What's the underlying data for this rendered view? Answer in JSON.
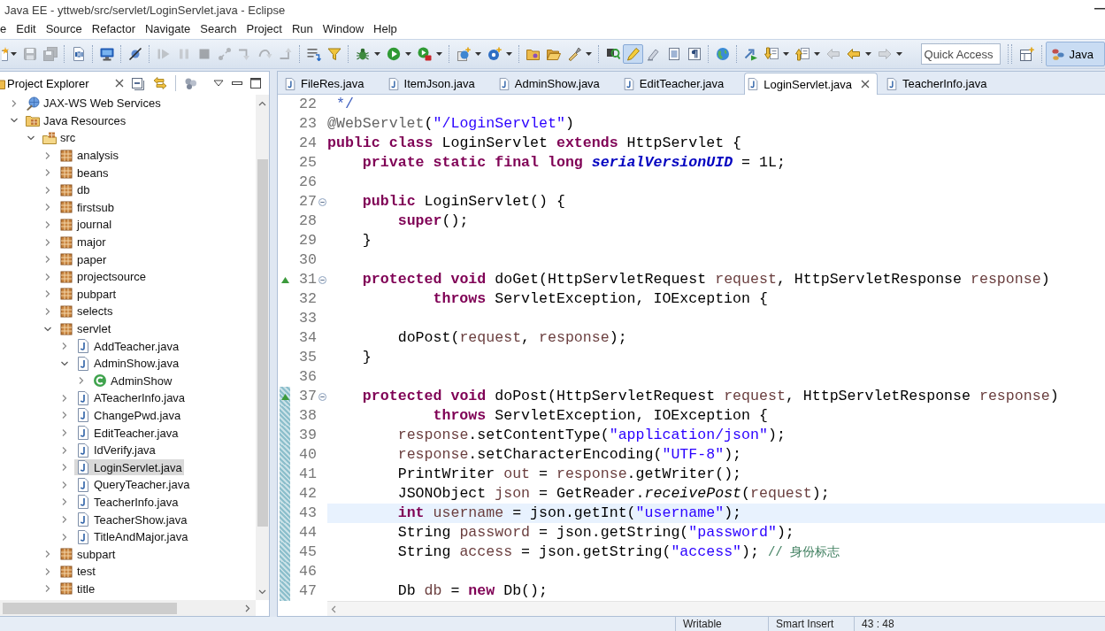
{
  "window": {
    "title": "Java EE - yttweb/src/servlet/LoginServlet.java - Eclipse"
  },
  "menu": [
    "e",
    "Edit",
    "Source",
    "Refactor",
    "Navigate",
    "Search",
    "Project",
    "Run",
    "Window",
    "Help"
  ],
  "toolbar": {
    "groups": [
      {
        "items": [
          {
            "kind": "new",
            "disabled": false,
            "pressed": false,
            "dropdown": true
          },
          {
            "kind": "save",
            "disabled": true,
            "pressed": false,
            "dropdown": false
          },
          {
            "kind": "save-all",
            "disabled": true,
            "pressed": false,
            "dropdown": false
          }
        ]
      },
      {
        "items": [
          {
            "kind": "binary",
            "disabled": false,
            "pressed": false,
            "dropdown": false
          }
        ]
      },
      {
        "items": [
          {
            "kind": "monitor",
            "disabled": false,
            "pressed": false,
            "dropdown": false
          }
        ]
      },
      {
        "items": [
          {
            "kind": "skip-breakpoints",
            "disabled": false,
            "pressed": false,
            "dropdown": false
          }
        ]
      },
      {
        "items": [
          {
            "kind": "resume",
            "disabled": true,
            "pressed": false,
            "dropdown": false
          },
          {
            "kind": "suspend",
            "disabled": true,
            "pressed": false,
            "dropdown": false
          },
          {
            "kind": "terminate",
            "disabled": true,
            "pressed": false,
            "dropdown": false
          },
          {
            "kind": "disconnect",
            "disabled": true,
            "pressed": false,
            "dropdown": false
          },
          {
            "kind": "step-into",
            "disabled": true,
            "pressed": false,
            "dropdown": false
          },
          {
            "kind": "step-over",
            "disabled": true,
            "pressed": false,
            "dropdown": false
          },
          {
            "kind": "step-return",
            "disabled": true,
            "pressed": false,
            "dropdown": false
          }
        ]
      },
      {
        "items": [
          {
            "kind": "step-filters",
            "disabled": false,
            "pressed": false,
            "dropdown": false
          },
          {
            "kind": "funnel",
            "disabled": false,
            "pressed": false,
            "dropdown": false
          }
        ]
      },
      {
        "items": [
          {
            "kind": "debug",
            "disabled": false,
            "pressed": false,
            "dropdown": true
          },
          {
            "kind": "run",
            "disabled": false,
            "pressed": false,
            "dropdown": true
          },
          {
            "kind": "external-tools",
            "disabled": false,
            "pressed": false,
            "dropdown": true
          }
        ]
      },
      {
        "items": [
          {
            "kind": "new-server",
            "disabled": false,
            "pressed": false,
            "dropdown": true
          },
          {
            "kind": "new-class",
            "disabled": false,
            "pressed": false,
            "dropdown": true
          }
        ]
      },
      {
        "items": [
          {
            "kind": "open-type",
            "disabled": false,
            "pressed": false,
            "dropdown": false
          },
          {
            "kind": "open-folder",
            "disabled": false,
            "pressed": false,
            "dropdown": false
          },
          {
            "kind": "brush",
            "disabled": false,
            "pressed": false,
            "dropdown": true
          }
        ]
      },
      {
        "items": [
          {
            "kind": "search-marker",
            "disabled": false,
            "pressed": false,
            "dropdown": false
          },
          {
            "kind": "highlighter",
            "disabled": false,
            "pressed": true,
            "dropdown": false
          },
          {
            "kind": "mark-occurrences",
            "disabled": false,
            "pressed": false,
            "dropdown": false
          },
          {
            "kind": "block-selection",
            "disabled": false,
            "pressed": false,
            "dropdown": false
          },
          {
            "kind": "whitespace",
            "disabled": false,
            "pressed": false,
            "dropdown": false
          }
        ]
      },
      {
        "items": [
          {
            "kind": "globe",
            "disabled": false,
            "pressed": false,
            "dropdown": false
          }
        ]
      },
      {
        "items": [
          {
            "kind": "run-last",
            "disabled": false,
            "pressed": false,
            "dropdown": false
          },
          {
            "kind": "next-annotation",
            "disabled": false,
            "pressed": false,
            "dropdown": true
          },
          {
            "kind": "prev-annotation",
            "disabled": false,
            "pressed": false,
            "dropdown": true
          },
          {
            "kind": "back-edit",
            "disabled": true,
            "pressed": false,
            "dropdown": false
          },
          {
            "kind": "back",
            "disabled": false,
            "pressed": false,
            "dropdown": true
          },
          {
            "kind": "forward",
            "disabled": true,
            "pressed": false,
            "dropdown": true
          }
        ]
      }
    ],
    "quick_access": {
      "placeholder": "Quick Access"
    },
    "perspectives": [
      {
        "label": "Java",
        "selected": true
      }
    ]
  },
  "project_explorer": {
    "title": "Project Explorer",
    "tree": [
      {
        "label": "JAX-WS Web Services",
        "kind": "services",
        "expanded": false,
        "selected": false
      },
      {
        "label": "Java Resources",
        "kind": "resources",
        "expanded": true,
        "selected": false,
        "children": [
          {
            "label": "src",
            "kind": "source-folder",
            "expanded": true,
            "selected": false,
            "children": [
              {
                "label": "analysis",
                "kind": "package",
                "expanded": false,
                "selected": false
              },
              {
                "label": "beans",
                "kind": "package",
                "expanded": false,
                "selected": false
              },
              {
                "label": "db",
                "kind": "package",
                "expanded": false,
                "selected": false
              },
              {
                "label": "firstsub",
                "kind": "package",
                "expanded": false,
                "selected": false
              },
              {
                "label": "journal",
                "kind": "package",
                "expanded": false,
                "selected": false
              },
              {
                "label": "major",
                "kind": "package",
                "expanded": false,
                "selected": false
              },
              {
                "label": "paper",
                "kind": "package",
                "expanded": false,
                "selected": false
              },
              {
                "label": "projectsource",
                "kind": "package",
                "expanded": false,
                "selected": false
              },
              {
                "label": "pubpart",
                "kind": "package",
                "expanded": false,
                "selected": false
              },
              {
                "label": "selects",
                "kind": "package",
                "expanded": false,
                "selected": false
              },
              {
                "label": "servlet",
                "kind": "package",
                "expanded": true,
                "selected": false,
                "children": [
                  {
                    "label": "AddTeacher.java",
                    "kind": "java-file",
                    "expanded": false,
                    "selected": false
                  },
                  {
                    "label": "AdminShow.java",
                    "kind": "java-file",
                    "expanded": true,
                    "selected": false,
                    "children": [
                      {
                        "label": "AdminShow",
                        "kind": "class",
                        "expanded": false,
                        "selected": false
                      }
                    ]
                  },
                  {
                    "label": "ATeacherInfo.java",
                    "kind": "java-file",
                    "expanded": false,
                    "selected": false
                  },
                  {
                    "label": "ChangePwd.java",
                    "kind": "java-file",
                    "expanded": false,
                    "selected": false
                  },
                  {
                    "label": "EditTeacher.java",
                    "kind": "java-file",
                    "expanded": false,
                    "selected": false
                  },
                  {
                    "label": "IdVerify.java",
                    "kind": "java-file",
                    "expanded": false,
                    "selected": false
                  },
                  {
                    "label": "LoginServlet.java",
                    "kind": "java-file",
                    "expanded": false,
                    "selected": true
                  },
                  {
                    "label": "QueryTeacher.java",
                    "kind": "java-file",
                    "expanded": false,
                    "selected": false
                  },
                  {
                    "label": "TeacherInfo.java",
                    "kind": "java-file",
                    "expanded": false,
                    "selected": false
                  },
                  {
                    "label": "TeacherShow.java",
                    "kind": "java-file",
                    "expanded": false,
                    "selected": false
                  },
                  {
                    "label": "TitleAndMajor.java",
                    "kind": "java-file",
                    "expanded": false,
                    "selected": false
                  }
                ]
              },
              {
                "label": "subpart",
                "kind": "package",
                "expanded": false,
                "selected": false
              },
              {
                "label": "test",
                "kind": "package",
                "expanded": false,
                "selected": false
              },
              {
                "label": "title",
                "kind": "package",
                "expanded": false,
                "selected": false
              }
            ]
          }
        ]
      }
    ]
  },
  "editor": {
    "tabs": [
      {
        "label": "FileRes.java",
        "selected": false
      },
      {
        "label": "ItemJson.java",
        "selected": false
      },
      {
        "label": "AdminShow.java",
        "selected": false
      },
      {
        "label": "EditTeacher.java",
        "selected": false
      },
      {
        "label": "LoginServlet.java",
        "selected": true
      },
      {
        "label": "TeacherInfo.java",
        "selected": false
      }
    ],
    "lines": [
      {
        "number": "22",
        "tokens": [
          {
            "kind": "javadoc",
            "text": " */"
          }
        ],
        "fold": false,
        "override": false,
        "changed": false,
        "current": false
      },
      {
        "number": "23",
        "tokens": [
          {
            "kind": "annotation",
            "text": "@WebServlet"
          },
          {
            "kind": "plain",
            "text": "("
          },
          {
            "kind": "string",
            "text": "\"/LoginServlet\""
          },
          {
            "kind": "plain",
            "text": ")"
          }
        ],
        "fold": false,
        "override": false,
        "changed": false,
        "current": false
      },
      {
        "number": "24",
        "tokens": [
          {
            "kind": "keyword",
            "text": "public "
          },
          {
            "kind": "keyword",
            "text": "class"
          },
          {
            "kind": "plain",
            "text": " LoginServlet "
          },
          {
            "kind": "keyword",
            "text": "extends"
          },
          {
            "kind": "plain",
            "text": " HttpServlet {"
          }
        ],
        "fold": false,
        "override": false,
        "changed": false,
        "current": false
      },
      {
        "number": "25",
        "tokens": [
          {
            "kind": "keyword",
            "text": "    private "
          },
          {
            "kind": "keyword",
            "text": "static "
          },
          {
            "kind": "keyword",
            "text": "final "
          },
          {
            "kind": "keyword",
            "text": "long "
          },
          {
            "kind": "static-field",
            "text": "serialVersionUID"
          },
          {
            "kind": "plain",
            "text": " = 1L;"
          }
        ],
        "fold": false,
        "override": false,
        "changed": false,
        "current": false
      },
      {
        "number": "26",
        "fold": false,
        "override": false,
        "changed": false,
        "current": false
      },
      {
        "number": "27",
        "tokens": [
          {
            "kind": "keyword",
            "text": "    public"
          },
          {
            "kind": "plain",
            "text": " LoginServlet() {"
          }
        ],
        "fold": true,
        "override": false,
        "changed": false,
        "current": false
      },
      {
        "number": "28",
        "tokens": [
          {
            "kind": "keyword",
            "text": "        super"
          },
          {
            "kind": "plain",
            "text": "();"
          }
        ],
        "fold": false,
        "override": false,
        "changed": false,
        "current": false
      },
      {
        "number": "29",
        "tokens": [
          {
            "kind": "plain",
            "text": "    }"
          }
        ],
        "fold": false,
        "override": false,
        "changed": false,
        "current": false
      },
      {
        "number": "30",
        "fold": false,
        "override": false,
        "changed": false,
        "current": false
      },
      {
        "number": "31",
        "tokens": [
          {
            "kind": "keyword",
            "text": "    protected "
          },
          {
            "kind": "keyword",
            "text": "void"
          },
          {
            "kind": "plain",
            "text": " doGet(HttpServletRequest "
          },
          {
            "kind": "variable",
            "text": "request"
          },
          {
            "kind": "plain",
            "text": ", HttpServletResponse "
          },
          {
            "kind": "variable",
            "text": "response"
          },
          {
            "kind": "plain",
            "text": ")"
          }
        ],
        "fold": true,
        "override": true,
        "changed": false,
        "current": false
      },
      {
        "number": "32",
        "tokens": [
          {
            "kind": "keyword",
            "text": "            throws"
          },
          {
            "kind": "plain",
            "text": " ServletException, IOException {"
          }
        ],
        "fold": false,
        "override": false,
        "changed": false,
        "current": false
      },
      {
        "number": "33",
        "fold": false,
        "override": false,
        "changed": false,
        "current": false
      },
      {
        "number": "34",
        "tokens": [
          {
            "kind": "plain",
            "text": "        doPost("
          },
          {
            "kind": "variable",
            "text": "request"
          },
          {
            "kind": "plain",
            "text": ", "
          },
          {
            "kind": "variable",
            "text": "response"
          },
          {
            "kind": "plain",
            "text": ");"
          }
        ],
        "fold": false,
        "override": false,
        "changed": false,
        "current": false
      },
      {
        "number": "35",
        "tokens": [
          {
            "kind": "plain",
            "text": "    }"
          }
        ],
        "fold": false,
        "override": false,
        "changed": false,
        "current": false
      },
      {
        "number": "36",
        "fold": false,
        "override": false,
        "changed": false,
        "current": false
      },
      {
        "number": "37",
        "tokens": [
          {
            "kind": "keyword",
            "text": "    protected "
          },
          {
            "kind": "keyword",
            "text": "void"
          },
          {
            "kind": "plain",
            "text": " doPost(HttpServletRequest "
          },
          {
            "kind": "variable",
            "text": "request"
          },
          {
            "kind": "plain",
            "text": ", HttpServletResponse "
          },
          {
            "kind": "variable",
            "text": "response"
          },
          {
            "kind": "plain",
            "text": ")"
          }
        ],
        "fold": true,
        "override": true,
        "changed": true,
        "current": false
      },
      {
        "number": "38",
        "tokens": [
          {
            "kind": "keyword",
            "text": "            throws"
          },
          {
            "kind": "plain",
            "text": " ServletException, IOException {"
          }
        ],
        "fold": false,
        "override": false,
        "changed": true,
        "current": false
      },
      {
        "number": "39",
        "tokens": [
          {
            "kind": "variable",
            "text": "        response"
          },
          {
            "kind": "plain",
            "text": ".setContentType("
          },
          {
            "kind": "string",
            "text": "\"application/json\""
          },
          {
            "kind": "plain",
            "text": ");"
          }
        ],
        "fold": false,
        "override": false,
        "changed": true,
        "current": false
      },
      {
        "number": "40",
        "tokens": [
          {
            "kind": "variable",
            "text": "        response"
          },
          {
            "kind": "plain",
            "text": ".setCharacterEncoding("
          },
          {
            "kind": "string",
            "text": "\"UTF-8\""
          },
          {
            "kind": "plain",
            "text": ");"
          }
        ],
        "fold": false,
        "override": false,
        "changed": true,
        "current": false
      },
      {
        "number": "41",
        "tokens": [
          {
            "kind": "plain",
            "text": "        PrintWriter "
          },
          {
            "kind": "variable",
            "text": "out"
          },
          {
            "kind": "plain",
            "text": " = "
          },
          {
            "kind": "variable",
            "text": "response"
          },
          {
            "kind": "plain",
            "text": ".getWriter();"
          }
        ],
        "fold": false,
        "override": false,
        "changed": true,
        "current": false
      },
      {
        "number": "42",
        "tokens": [
          {
            "kind": "plain",
            "text": "        JSONObject "
          },
          {
            "kind": "variable",
            "text": "json"
          },
          {
            "kind": "plain",
            "text": " = GetReader."
          },
          {
            "kind": "static-method",
            "text": "receivePost"
          },
          {
            "kind": "plain",
            "text": "("
          },
          {
            "kind": "variable",
            "text": "request"
          },
          {
            "kind": "plain",
            "text": ");"
          }
        ],
        "fold": false,
        "override": false,
        "changed": true,
        "current": false
      },
      {
        "number": "43",
        "tokens": [
          {
            "kind": "keyword",
            "text": "        int "
          },
          {
            "kind": "variable",
            "text": "username"
          },
          {
            "kind": "plain",
            "text": " = json.getInt("
          },
          {
            "kind": "string",
            "text": "\"username\""
          },
          {
            "kind": "plain",
            "text": ");"
          }
        ],
        "fold": false,
        "override": false,
        "changed": true,
        "current": true
      },
      {
        "number": "44",
        "tokens": [
          {
            "kind": "plain",
            "text": "        String "
          },
          {
            "kind": "variable",
            "text": "password"
          },
          {
            "kind": "plain",
            "text": " = json.getString("
          },
          {
            "kind": "string",
            "text": "\"password\""
          },
          {
            "kind": "plain",
            "text": ");"
          }
        ],
        "fold": false,
        "override": false,
        "changed": true,
        "current": false
      },
      {
        "number": "45",
        "tokens": [
          {
            "kind": "plain",
            "text": "        String "
          },
          {
            "kind": "variable",
            "text": "access"
          },
          {
            "kind": "plain",
            "text": " = json.getString("
          },
          {
            "kind": "string",
            "text": "\"access\""
          },
          {
            "kind": "plain",
            "text": "); "
          },
          {
            "kind": "comment",
            "text": "// 身份标志"
          }
        ],
        "fold": false,
        "override": false,
        "changed": true,
        "current": false
      },
      {
        "number": "46",
        "fold": false,
        "override": false,
        "changed": true,
        "current": false
      },
      {
        "number": "47",
        "tokens": [
          {
            "kind": "plain",
            "text": "        Db "
          },
          {
            "kind": "variable",
            "text": "db"
          },
          {
            "kind": "plain",
            "text": " = "
          },
          {
            "kind": "keyword",
            "text": "new"
          },
          {
            "kind": "plain",
            "text": " Db();"
          }
        ],
        "fold": false,
        "override": false,
        "changed": true,
        "current": false
      }
    ]
  },
  "status_bar": [
    "Writable",
    "Smart Insert",
    "43 : 48"
  ]
}
